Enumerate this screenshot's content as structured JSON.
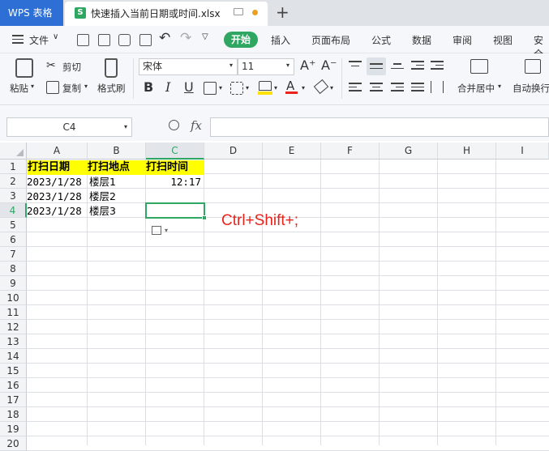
{
  "app": {
    "title": "WPS 表格"
  },
  "file_tab": {
    "name": "快速插入当前日期或时间.xlsx",
    "icon_letter": "S"
  },
  "menu": {
    "file": "文件",
    "tabs": [
      "开始",
      "插入",
      "页面布局",
      "公式",
      "数据",
      "审阅",
      "视图",
      "安全"
    ]
  },
  "ribbon": {
    "paste": "粘贴",
    "cut": "剪切",
    "copy": "复制",
    "format_painter": "格式刷",
    "font_name": "宋体",
    "font_size": "11",
    "merge_center": "合并居中",
    "wrap_text": "自动换行",
    "bold": "B",
    "italic": "I",
    "underline": "U"
  },
  "formula_bar": {
    "name_box": "C4",
    "fx": "fx",
    "formula": ""
  },
  "columns": [
    "A",
    "B",
    "C",
    "D",
    "E",
    "F",
    "G",
    "H",
    "I"
  ],
  "rows": [
    "1",
    "2",
    "3",
    "4",
    "5",
    "6",
    "7",
    "8",
    "9",
    "10",
    "11",
    "12",
    "13",
    "14",
    "15",
    "16",
    "17",
    "18",
    "19",
    "20"
  ],
  "cells": {
    "A1": "打扫日期",
    "B1": "打扫地点",
    "C1": "打扫时间",
    "A2": "2023/1/28",
    "B2": "楼层1",
    "C2": "12:17",
    "A3": "2023/1/28",
    "B3": "楼层2",
    "A4": "2023/1/28",
    "B4": "楼层3"
  },
  "annotation": {
    "text": "Ctrl+Shift+;",
    "color": "#e8231c"
  },
  "selected_cell": "C4",
  "colors": {
    "accent": "#2fa662",
    "app_blue": "#2e6fd6",
    "header_fill": "#ffff00"
  }
}
